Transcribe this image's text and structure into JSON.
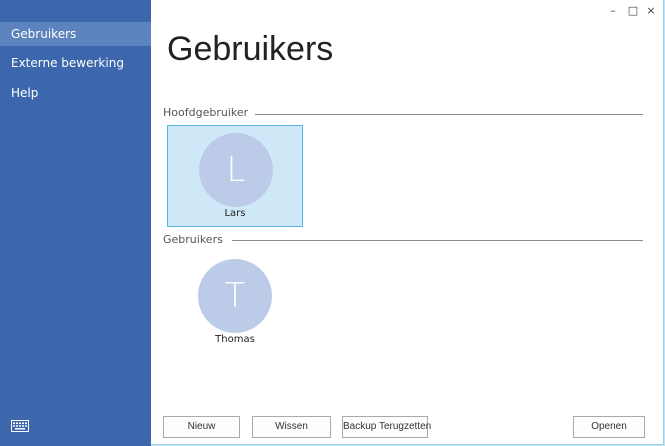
{
  "sidebar": {
    "items": [
      {
        "label": "Gebruikers"
      },
      {
        "label": "Externe bewerking"
      },
      {
        "label": "Help"
      }
    ],
    "keyboard_icon": "keyboard-icon"
  },
  "window_controls": {
    "minimize": "–",
    "maximize": "□",
    "close": "×"
  },
  "main": {
    "title": "Gebruikers",
    "sections": [
      {
        "label": "Hoofdgebruiker",
        "users": [
          {
            "initial": "L",
            "name": "Lars",
            "selected": true
          }
        ]
      },
      {
        "label": "Gebruikers",
        "users": [
          {
            "initial": "T",
            "name": "Thomas",
            "selected": false
          }
        ]
      }
    ]
  },
  "footer": {
    "new_label": "Nieuw",
    "delete_label": "Wissen",
    "restore_label": "Backup Terugzetten",
    "open_label": "Openen"
  },
  "colors": {
    "sidebar": "#3c67ac",
    "sidebar_selected": "#5d83bf",
    "avatar": "#bccbe8",
    "tile_selected": "#cfe8f8",
    "tile_border": "#55b4e8"
  }
}
